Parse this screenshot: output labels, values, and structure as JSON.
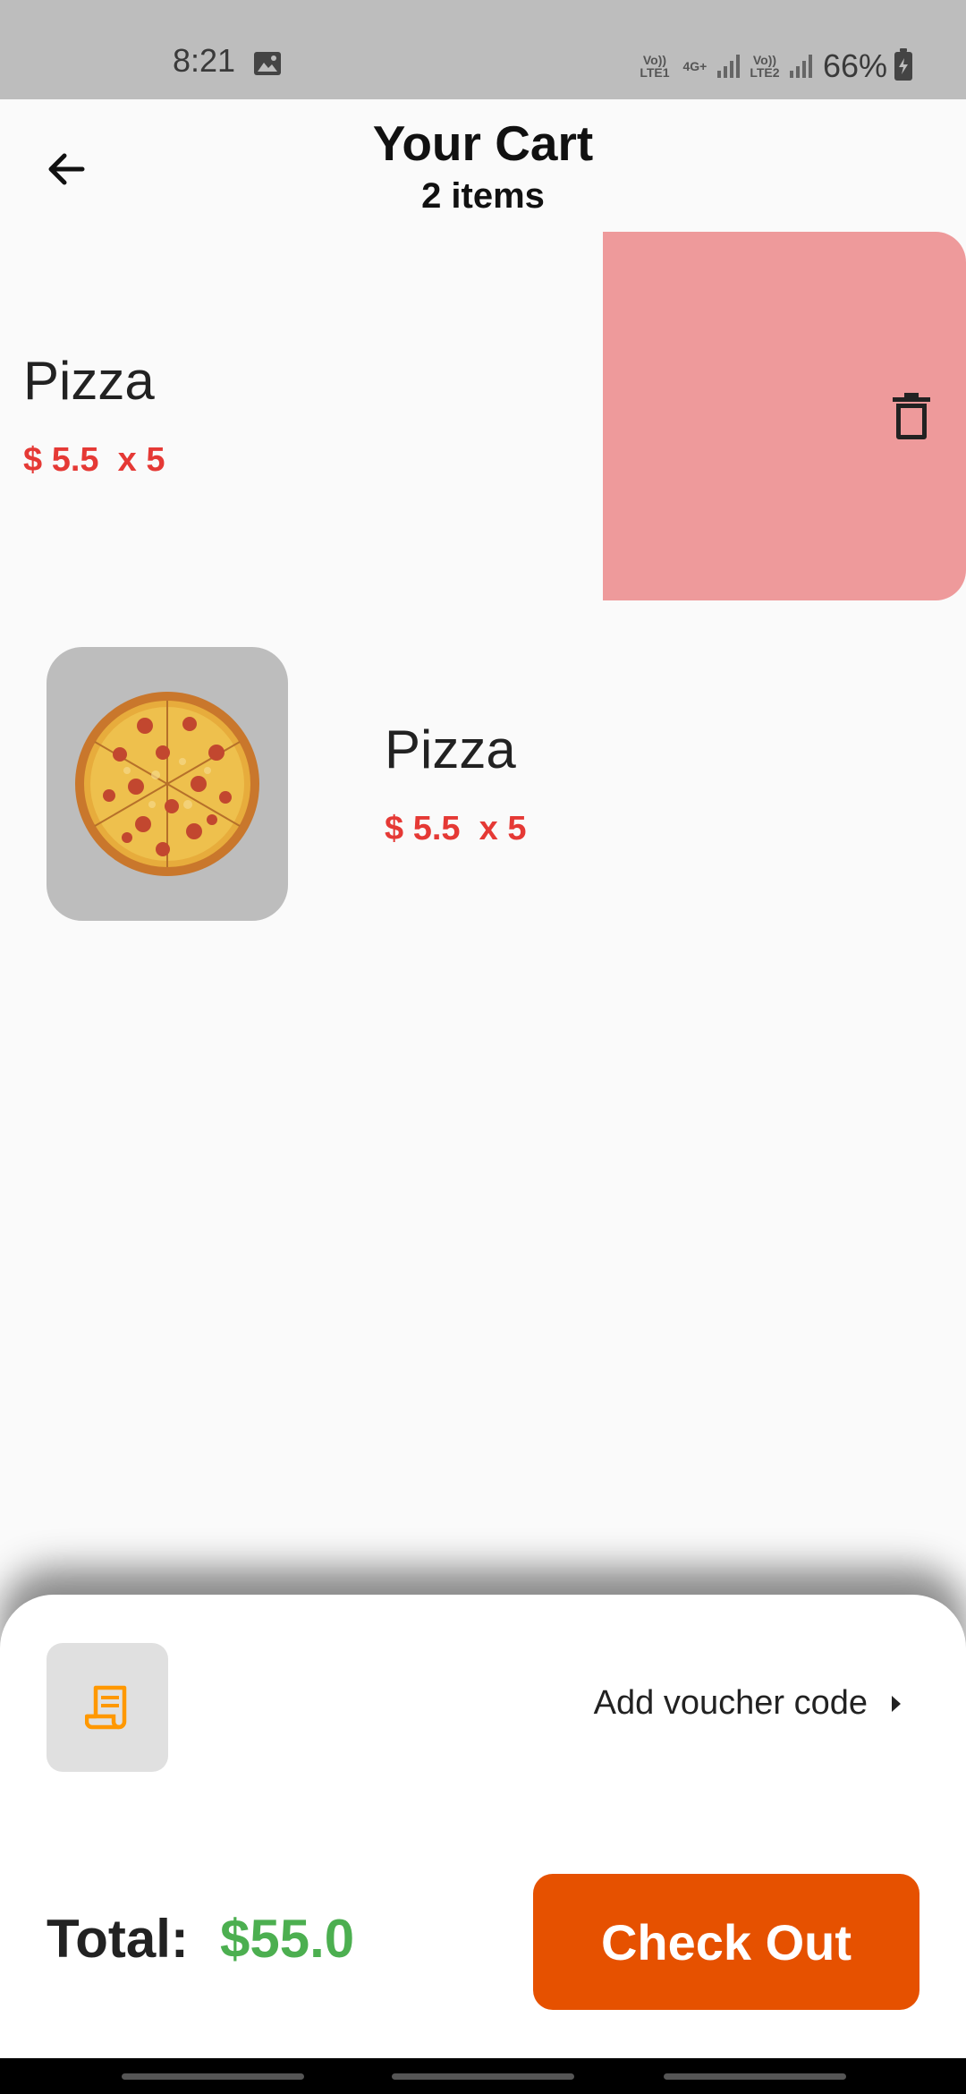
{
  "status_bar": {
    "time": "8:21",
    "sim1_label": "Vo)) LTE1",
    "net_label": "4G+",
    "sim2_label": "Vo)) LTE2",
    "battery": "66%",
    "icons": [
      "gallery-icon",
      "signal-icon",
      "battery-charging-icon"
    ]
  },
  "app_bar": {
    "back_icon": "arrow-back-icon",
    "title": "Your Cart",
    "subtitle": "2 items"
  },
  "cart": {
    "items": [
      {
        "name": "Pizza",
        "price": "$ 5.5  x 5",
        "state": "swiped",
        "action_icon": "trash-icon",
        "action_color": "#ee9a9b"
      },
      {
        "name": "Pizza",
        "price": "$ 5.5  x 5",
        "image": "pizza-image"
      }
    ]
  },
  "voucher": {
    "icon": "receipt-icon",
    "icon_color": "#ff9800",
    "label": "Add voucher code",
    "chevron_icon": "arrow-right-icon"
  },
  "total": {
    "label": "Total:",
    "value": "$55.0",
    "value_color": "#4caf50"
  },
  "checkout": {
    "label": "Check Out",
    "color": "#e65100"
  },
  "colors": {
    "price": "#e53935",
    "status_bar": "#bdbdbd",
    "background": "#fafafa"
  }
}
